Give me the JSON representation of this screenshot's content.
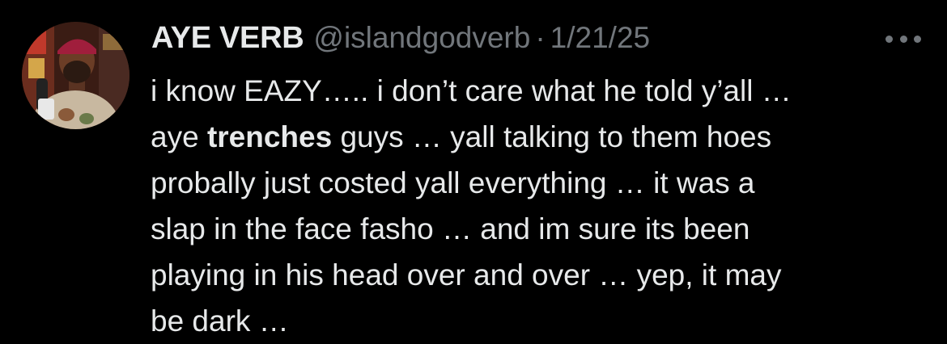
{
  "tweet": {
    "author": {
      "display_name": "AYE VERB",
      "handle": "@islandgodverb",
      "avatar": "profile-photo"
    },
    "separator": "·",
    "date": "1/21/25",
    "more_icon": "more-horizontal-icon",
    "text_lines": [
      {
        "segments": [
          {
            "text": "i know EAZY….. i don’t care what he told y’all …"
          }
        ]
      },
      {
        "segments": [
          {
            "text": "aye "
          },
          {
            "text": "trenches",
            "bold": true
          },
          {
            "text": " guys … yall talking to them hoes"
          }
        ]
      },
      {
        "segments": [
          {
            "text": "probally just costed yall everything … it was a"
          }
        ]
      },
      {
        "segments": [
          {
            "text": "slap in the face fasho … and im sure its been"
          }
        ]
      },
      {
        "segments": [
          {
            "text": "playing in his head over and over … yep, it may"
          }
        ]
      },
      {
        "segments": [
          {
            "text": "be dark …"
          }
        ]
      }
    ]
  },
  "colors": {
    "background": "#000000",
    "primary_text": "#e7e9ea",
    "secondary_text": "#71767b"
  }
}
